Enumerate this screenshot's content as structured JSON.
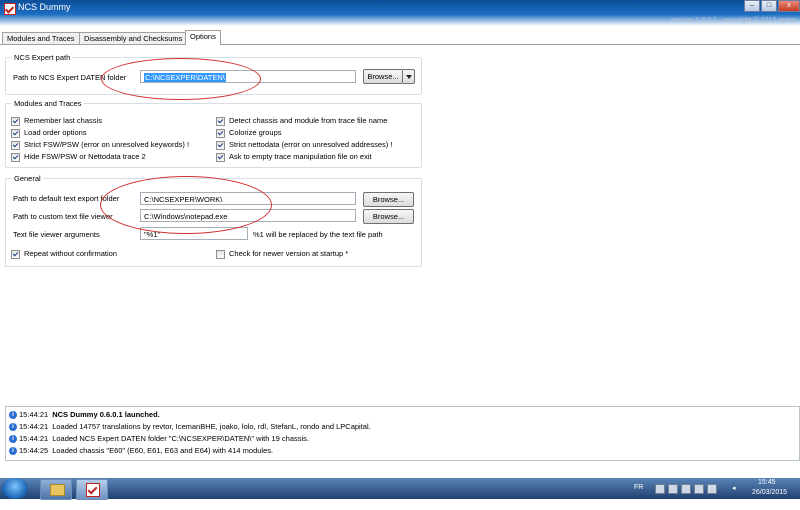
{
  "window": {
    "title": "NCS Dummy",
    "version": "version 0.6.0.1 - copyright © 2013 revtor",
    "controls": {
      "minimize": "–",
      "maximize": "□",
      "close": "x"
    }
  },
  "tabs": [
    {
      "label": "Modules and Traces"
    },
    {
      "label": "Disassembly and Checksums"
    },
    {
      "label": "Options"
    }
  ],
  "ncs_expert_path": {
    "group_label": "NCS Expert path",
    "label": "Path to NCS Expert DATEN folder",
    "value": "C:\\NCSEXPER\\DATEN\\",
    "browse_label": "Browse..."
  },
  "modules_and_traces": {
    "group_label": "Modules and Traces",
    "options": [
      {
        "label": "Remember last chassis",
        "checked": true
      },
      {
        "label": "Load order options",
        "checked": true
      },
      {
        "label": "Strict FSW/PSW (error on unresolved keywords) !",
        "checked": true
      },
      {
        "label": "Hide FSW/PSW or Nettodata trace 2",
        "checked": true
      },
      {
        "label": "Detect chassis and module from trace file name",
        "checked": true
      },
      {
        "label": "Colorize groups",
        "checked": true
      },
      {
        "label": "Strict nettodata (error on unresolved addresses) !",
        "checked": true
      },
      {
        "label": "Ask to empty trace manipulation file on exit",
        "checked": true
      }
    ]
  },
  "general": {
    "group_label": "General",
    "export_label": "Path to default text export folder",
    "export_value": "C:\\NCSEXPER\\WORK\\",
    "viewer_label": "Path to custom text file viewer",
    "viewer_value": "C:\\Windows\\notepad.exe",
    "args_label": "Text file viewer arguments",
    "args_value": "\"%1\"",
    "args_hint": "%1 will be replaced by the text file path",
    "browse_label": "Browse...",
    "repeat_label": "Repeat without confirmation",
    "repeat_checked": true,
    "newver_label": "Check for newer version at startup *",
    "newver_checked": false
  },
  "log": [
    {
      "time": "15:44:21",
      "text": "NCS Dummy 0.6.0.1 launched.",
      "bold": true
    },
    {
      "time": "15:44:21",
      "text": "Loaded 14757 translations by revtor, IcemanBHE, joako, lolo, rdl, StefanL, rondo and LPCapital.",
      "bold": false
    },
    {
      "time": "15:44:21",
      "text": "Loaded NCS Expert DATEN folder \"C:\\NCSEXPER\\DATEN\\\" with 19 chassis.",
      "bold": false
    },
    {
      "time": "15:44:25",
      "text": "Loaded chassis \"E60\" (E60, E61, E63 and E64) with 414 modules.",
      "bold": false
    }
  ],
  "taskbar": {
    "language": "FR",
    "time": "15:45",
    "date": "26/03/2015"
  },
  "colors": {
    "title_bar": "#1c6dc2",
    "annotation": "#d03030",
    "taskbar": "#2f5a90",
    "selection": "#3399ff"
  }
}
